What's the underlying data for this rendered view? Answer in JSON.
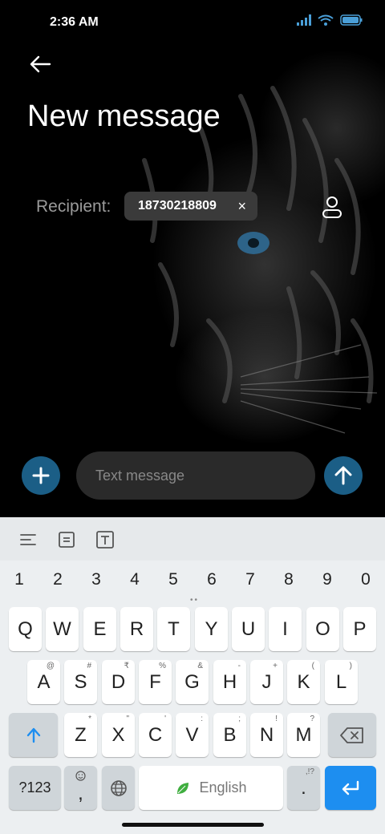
{
  "status_bar": {
    "time": "2:36 AM"
  },
  "header": {
    "title": "New message"
  },
  "recipient": {
    "label": "Recipient:",
    "chip_number": "18730218809",
    "remove_symbol": "×"
  },
  "composer": {
    "placeholder": "Text message"
  },
  "keyboard": {
    "digits": [
      "1",
      "2",
      "3",
      "4",
      "5",
      "6",
      "7",
      "8",
      "9",
      "0"
    ],
    "row1": [
      "Q",
      "W",
      "E",
      "R",
      "T",
      "Y",
      "U",
      "I",
      "O",
      "P"
    ],
    "row2": [
      {
        "key": "A",
        "sup": "@"
      },
      {
        "key": "S",
        "sup": "#"
      },
      {
        "key": "D",
        "sup": "₹"
      },
      {
        "key": "F",
        "sup": "%"
      },
      {
        "key": "G",
        "sup": "&"
      },
      {
        "key": "H",
        "sup": "-"
      },
      {
        "key": "J",
        "sup": "+"
      },
      {
        "key": "K",
        "sup": "("
      },
      {
        "key": "L",
        "sup": ")"
      }
    ],
    "row3": [
      {
        "key": "Z",
        "sup": "*"
      },
      {
        "key": "X",
        "sup": "\""
      },
      {
        "key": "C",
        "sup": "'"
      },
      {
        "key": "V",
        "sup": ":"
      },
      {
        "key": "B",
        "sup": ";"
      },
      {
        "key": "N",
        "sup": "!"
      },
      {
        "key": "M",
        "sup": "?"
      }
    ],
    "symbols_key": "?123",
    "comma_key": ",",
    "space_label": "English",
    "period_key": ".",
    "period_sup": ",!?"
  },
  "colors": {
    "accent_button": "#1b5e86",
    "enter_key": "#1d8ef0"
  }
}
